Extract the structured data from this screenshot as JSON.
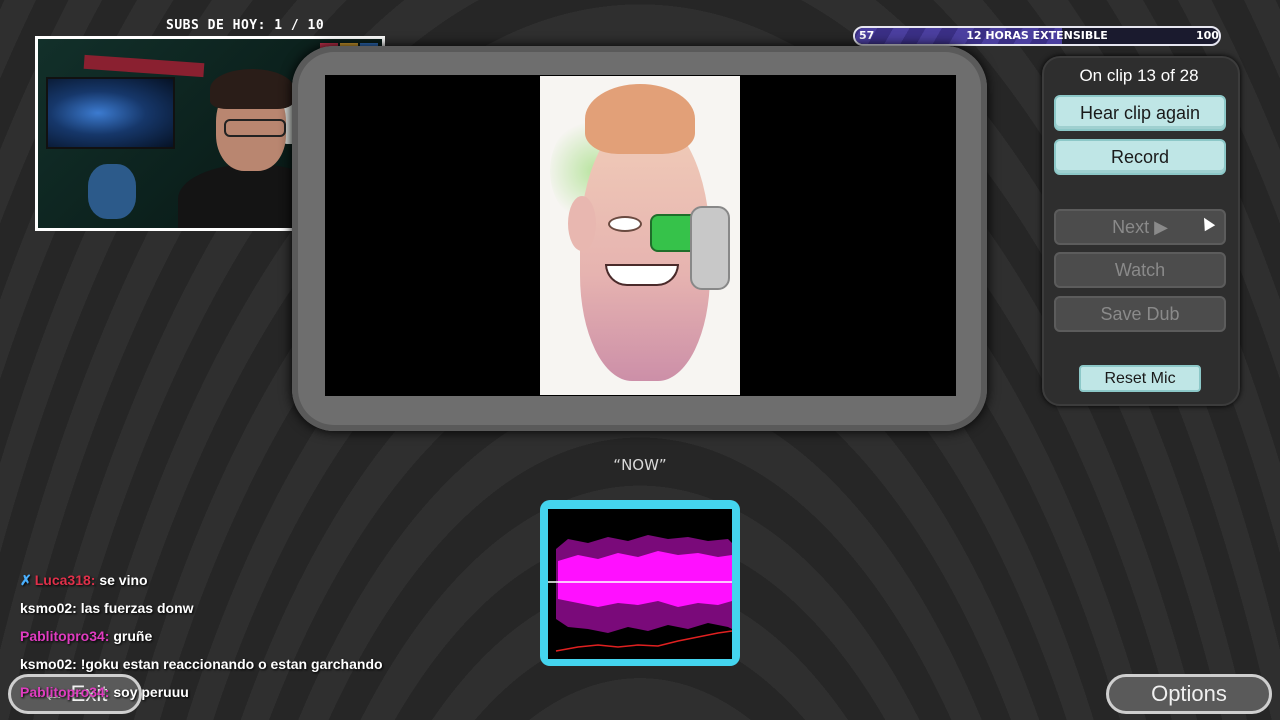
{
  "overlay": {
    "subs_label": "SUBS DE HOY: 1 / 10",
    "meter": {
      "min": "57",
      "label": "12 HORAS EXTENSIBLE",
      "max": "100",
      "fill_color": "#4b3f9f"
    }
  },
  "game": {
    "clip_counter": "On clip 13 of 28",
    "buttons": {
      "hear_again": "Hear clip again",
      "record": "Record",
      "next": "Next ▶",
      "watch": "Watch",
      "save_dub": "Save Dub",
      "reset_mic": "Reset Mic"
    },
    "line_text": "“NOW”",
    "exit_label": "Exit",
    "exit_icon": "←",
    "options_label": "Options",
    "accent_color": "#bfe6e6",
    "wave_color": "#ff10ff"
  },
  "chat": [
    {
      "user": "Luca318:",
      "message": "se vino",
      "color": "#e0304a",
      "badge": "sword-icon"
    },
    {
      "user": "ksmo02:",
      "message": "las fuerzas donw",
      "color": "#ffffff"
    },
    {
      "user": "Pablitopro34:",
      "message": "gruñe",
      "color": "#e03cc0"
    },
    {
      "user": "ksmo02:",
      "message": "!goku estan reaccionando o estan garchando",
      "color": "#ffffff"
    },
    {
      "user": "Pablitopro34:",
      "message": "soy peruuu",
      "color": "#e03cc0"
    }
  ]
}
